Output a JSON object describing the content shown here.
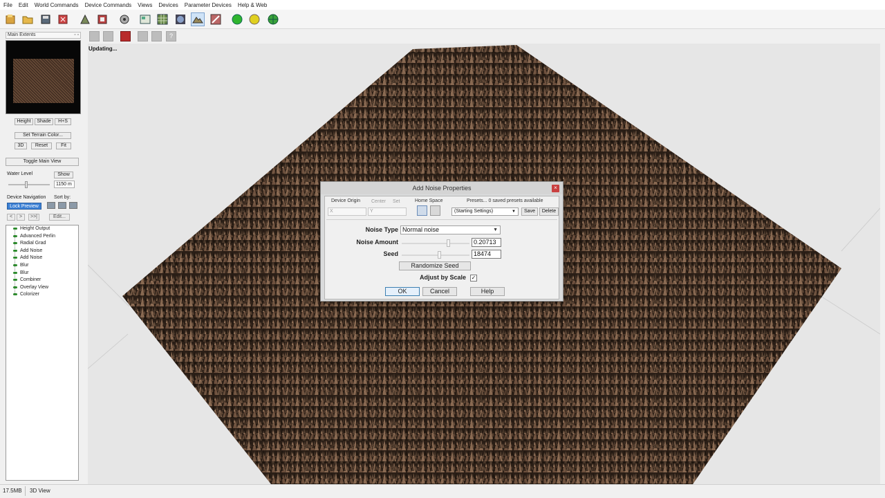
{
  "menu": [
    "File",
    "Edit",
    "World Commands",
    "Device Commands",
    "Views",
    "Devices",
    "Parameter Devices",
    "Help & Web"
  ],
  "toolbar_icons": [
    "new-icon",
    "open-icon",
    "save-icon",
    "settings-icon",
    "build-icon",
    "export-icon",
    "render-icon",
    "layout-icon",
    "grid-icon",
    "sphere-icon",
    "terrain-view-icon",
    "erase-icon",
    "green-light-icon",
    "yellow-light-icon",
    "globe-icon"
  ],
  "left": {
    "title": "Main Extents",
    "view_buttons": [
      "Height",
      "Shade",
      "H+S"
    ],
    "set_color": "Set Terrain Color...",
    "view_buttons2": [
      "3D",
      "Reset",
      "Fit"
    ],
    "toggle_main": "Toggle Main View",
    "water_level_label": "Water Level",
    "water_show": "Show",
    "water_value": "1150 m",
    "device_nav_label": "Device Navigation",
    "sort_by_label": "Sort by:",
    "lock_preview": "Lock Preview",
    "nav_buttons": [
      "<",
      ">",
      ">>|"
    ],
    "edit_button": "Edit...",
    "tree": [
      "Height Output",
      "Advanced Perlin",
      "Radial Grad",
      "Add Noise",
      "Add Noise",
      "Blur",
      "Blur",
      "Combiner",
      "Overlay View",
      "Colorizer"
    ]
  },
  "viewport": {
    "status": "Updating...",
    "help_glyph": "?"
  },
  "dialog": {
    "title": "Add Noise Properties",
    "close_glyph": "×",
    "device_origin": "Device Origin",
    "center": "Center",
    "set": "Set",
    "x_label": "X",
    "y_label": "Y",
    "home_space": "Home Space",
    "presets_label": "Presets... 0 saved presets available",
    "preset_value": "(Starting Settings)",
    "save": "Save",
    "delete": "Delete",
    "noise_type_label": "Noise Type",
    "noise_type_value": "Normal noise",
    "noise_amount_label": "Noise Amount",
    "noise_amount_value": "0.20713",
    "noise_amount_fraction": 0.7,
    "seed_label": "Seed",
    "seed_value": "18474",
    "seed_fraction": 0.56,
    "randomize": "Randomize Seed",
    "adjust_by_scale": "Adjust by Scale",
    "adjust_checked": "✓",
    "ok": "OK",
    "cancel": "Cancel",
    "help": "Help"
  },
  "status": {
    "memory": "17.5MB",
    "view": "3D View"
  },
  "colors": {
    "terrain_dark": "#2a1e16",
    "terrain_light": "#8a6a52",
    "background": "#e6e6e6",
    "accent": "#3a7fd4"
  }
}
